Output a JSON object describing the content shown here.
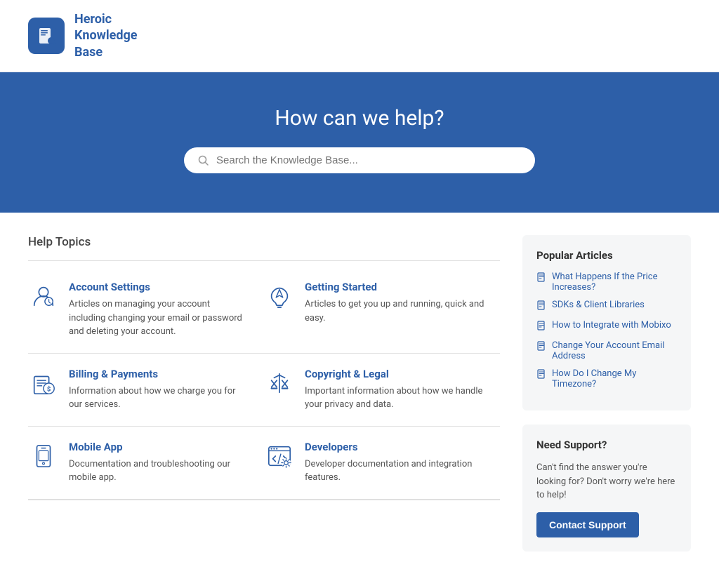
{
  "header": {
    "logo_alt": "Heroic Knowledge Base",
    "logo_line1": "Heroic",
    "logo_line2": "Knowledge",
    "logo_line3": "Base"
  },
  "hero": {
    "title": "How can we help?",
    "search_placeholder": "Search the Knowledge Base..."
  },
  "topics": {
    "section_title": "Help Topics",
    "items": [
      {
        "id": "account-settings",
        "title": "Account Settings",
        "description": "Articles on managing your account including changing your email or password and deleting your account.",
        "icon": "user"
      },
      {
        "id": "getting-started",
        "title": "Getting Started",
        "description": "Articles to get you up and running, quick and easy.",
        "icon": "rocket"
      },
      {
        "id": "billing-payments",
        "title": "Billing & Payments",
        "description": "Information about how we charge you for our services.",
        "icon": "billing"
      },
      {
        "id": "copyright-legal",
        "title": "Copyright & Legal",
        "description": "Important information about how we handle your privacy and data.",
        "icon": "legal"
      },
      {
        "id": "mobile-app",
        "title": "Mobile App",
        "description": "Documentation and troubleshooting our mobile app.",
        "icon": "mobile"
      },
      {
        "id": "developers",
        "title": "Developers",
        "description": "Developer documentation and integration features.",
        "icon": "developers"
      }
    ]
  },
  "popular_articles": {
    "title": "Popular Articles",
    "items": [
      "What Happens If the Price Increases?",
      "SDKs & Client Libraries",
      "How to Integrate with Mobixo",
      "Change Your Account Email Address",
      "How Do I Change My Timezone?"
    ]
  },
  "need_support": {
    "title": "Need Support?",
    "description": "Can't find the answer you're looking for? Don't worry we're here to help!",
    "button_label": "Contact Support"
  }
}
